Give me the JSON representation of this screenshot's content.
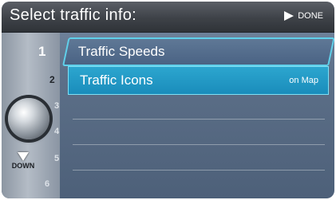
{
  "header": {
    "title": "Select traffic info:",
    "done_label": "DONE"
  },
  "rail": {
    "numbers": [
      "1",
      "2",
      "3",
      "4",
      "5",
      "6"
    ],
    "down_label": "DOWN"
  },
  "menu": {
    "items": [
      {
        "label": "Traffic Speeds",
        "status": ""
      },
      {
        "label": "Traffic Icons",
        "status": "on Map"
      }
    ]
  },
  "colors": {
    "highlight": "#2ca6cf",
    "outline": "#5fd0ea",
    "header": "#3e4248"
  }
}
